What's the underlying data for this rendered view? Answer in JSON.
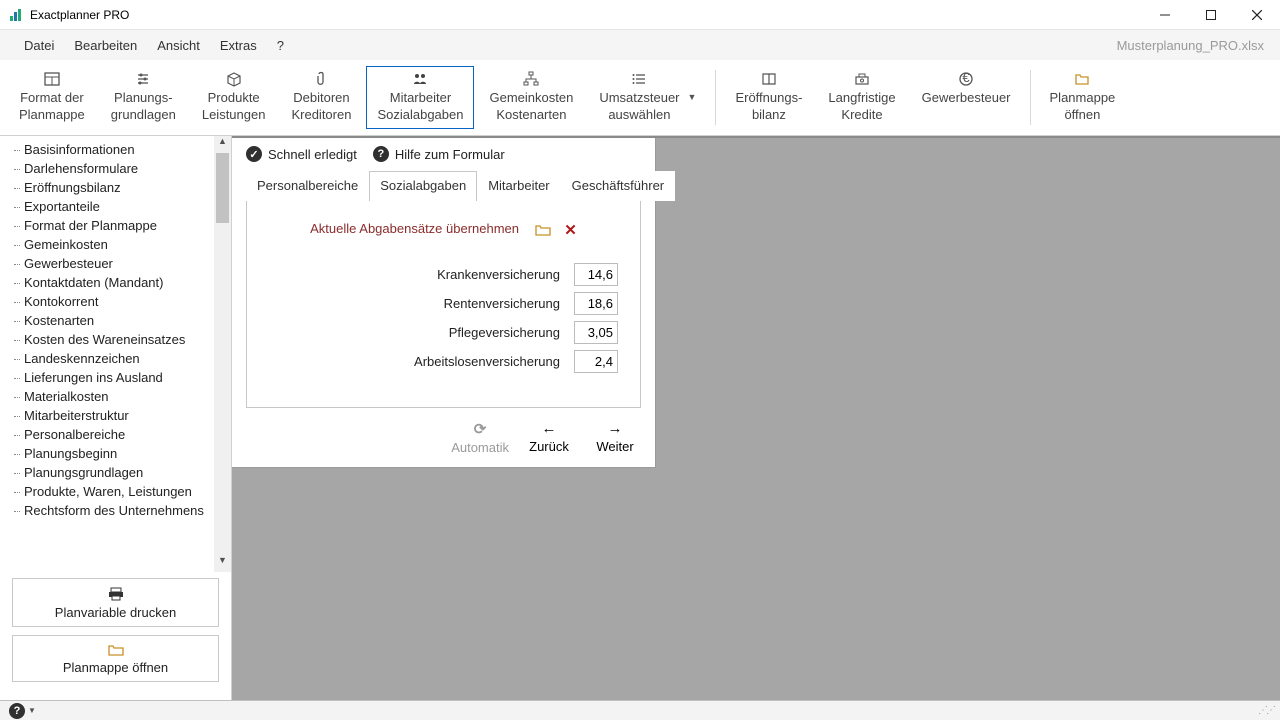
{
  "window": {
    "title": "Exactplanner PRO"
  },
  "menu": {
    "items": [
      "Datei",
      "Bearbeiten",
      "Ansicht",
      "Extras",
      "?"
    ],
    "filename": "Musterplanung_PRO.xlsx"
  },
  "ribbon": {
    "buttons": [
      {
        "id": "format",
        "l1": "Format der",
        "l2": "Planmappe"
      },
      {
        "id": "grundlagen",
        "l1": "Planungs-",
        "l2": "grundlagen"
      },
      {
        "id": "produkte",
        "l1": "Produkte",
        "l2": "Leistungen"
      },
      {
        "id": "debitoren",
        "l1": "Debitoren",
        "l2": "Kreditoren"
      },
      {
        "id": "mitarbeiter",
        "l1": "Mitarbeiter",
        "l2": "Sozialabgaben",
        "selected": true
      },
      {
        "id": "gemeinkosten",
        "l1": "Gemeinkosten",
        "l2": "Kostenarten"
      },
      {
        "id": "umsatzsteuer",
        "l1": "Umsatzsteuer",
        "l2": "auswählen",
        "caret": true
      },
      {
        "id": "eroeffnung",
        "l1": "Eröffnungs-",
        "l2": "bilanz"
      },
      {
        "id": "kredite",
        "l1": "Langfristige",
        "l2": "Kredite"
      },
      {
        "id": "gewerbesteuer",
        "l1": "Gewerbesteuer",
        "l2": ""
      },
      {
        "id": "oeffnen",
        "l1": "Planmappe",
        "l2": "öffnen"
      }
    ]
  },
  "tree": {
    "items": [
      "Basisinformationen",
      "Darlehensformulare",
      "Eröffnungsbilanz",
      "Exportanteile",
      "Format der Planmappe",
      "Gemeinkosten",
      "Gewerbesteuer",
      "Kontaktdaten (Mandant)",
      "Kontokorrent",
      "Kostenarten",
      "Kosten des Wareneinsatzes",
      "Landeskennzeichen",
      "Lieferungen ins Ausland",
      "Materialkosten",
      "Mitarbeiterstruktur",
      "Personalbereiche",
      "Planungsbeginn",
      "Planungsgrundlagen",
      "Produkte, Waren, Leistungen",
      "Rechtsform des Unternehmens"
    ]
  },
  "leftButtons": {
    "print": "Planvariable drucken",
    "open": "Planmappe öffnen"
  },
  "panel": {
    "header": {
      "done": "Schnell erledigt",
      "help": "Hilfe zum Formular"
    },
    "tabs": [
      "Personalbereiche",
      "Sozialabgaben",
      "Mitarbeiter",
      "Geschäftsführer"
    ],
    "activeTab": 1,
    "importLabel": "Aktuelle Abgabensätze übernehmen",
    "fields": [
      {
        "label": "Krankenversicherung",
        "value": "14,6"
      },
      {
        "label": "Rentenversicherung",
        "value": "18,6"
      },
      {
        "label": "Pflegeversicherung",
        "value": "3,05"
      },
      {
        "label": "Arbeitslosenversicherung",
        "value": "2,4"
      }
    ],
    "footer": {
      "auto": "Automatik",
      "back": "Zurück",
      "next": "Weiter"
    }
  }
}
